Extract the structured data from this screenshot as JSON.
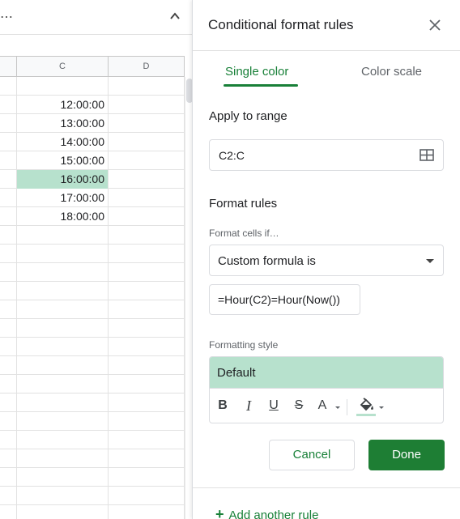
{
  "sheet": {
    "columns": [
      "C",
      "D"
    ],
    "rows": [
      {
        "c": ""
      },
      {
        "c": "12:00:00"
      },
      {
        "c": "13:00:00"
      },
      {
        "c": "14:00:00"
      },
      {
        "c": "15:00:00"
      },
      {
        "c": "16:00:00",
        "highlight": true
      },
      {
        "c": "17:00:00"
      },
      {
        "c": "18:00:00"
      },
      {
        "c": ""
      },
      {
        "c": ""
      },
      {
        "c": ""
      },
      {
        "c": ""
      },
      {
        "c": ""
      },
      {
        "c": ""
      },
      {
        "c": ""
      },
      {
        "c": ""
      },
      {
        "c": ""
      },
      {
        "c": ""
      },
      {
        "c": ""
      },
      {
        "c": ""
      },
      {
        "c": ""
      },
      {
        "c": ""
      },
      {
        "c": ""
      },
      {
        "c": ""
      }
    ],
    "highlight_color": "#b7e1cd"
  },
  "panel": {
    "title": "Conditional format rules",
    "tabs": [
      {
        "label": "Single color",
        "active": true
      },
      {
        "label": "Color scale",
        "active": false
      }
    ],
    "apply_range_label": "Apply to range",
    "range_value": "C2:C",
    "format_rules_label": "Format rules",
    "format_cells_if_label": "Format cells if…",
    "condition_value": "Custom formula is",
    "formula_value": "=Hour(C2)=Hour(Now())",
    "formatting_style_label": "Formatting style",
    "style_preview": "Default",
    "format_buttons": {
      "bold": "B",
      "italic": "I",
      "underline": "U",
      "strike": "S",
      "text_color": "A"
    },
    "cancel_label": "Cancel",
    "done_label": "Done",
    "add_rule_label": "Add another rule",
    "accent_color": "#188038"
  }
}
